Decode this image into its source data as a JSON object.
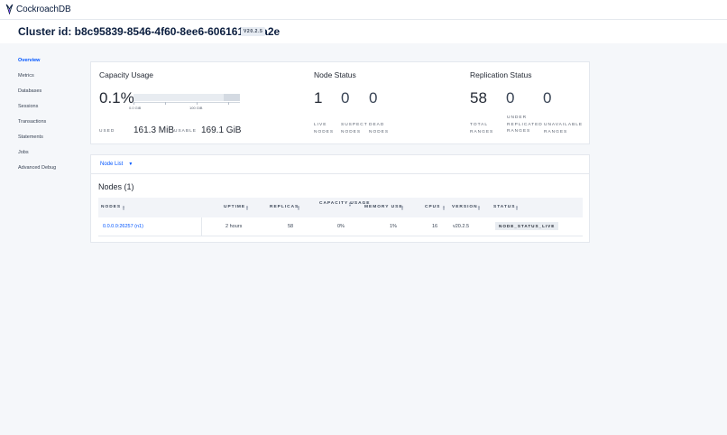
{
  "brand": {
    "name": "CockroachDB",
    "logo_icon": "cockroach-logo-icon"
  },
  "header": {
    "title": "Cluster id: b8c95839-8546-4f60-8ee6-606161ee8a2e",
    "version": "V20.2.5"
  },
  "sidebar": {
    "items": [
      {
        "label": "Overview",
        "active": true
      },
      {
        "label": "Metrics",
        "active": false
      },
      {
        "label": "Databases",
        "active": false
      },
      {
        "label": "Sessions",
        "active": false
      },
      {
        "label": "Transactions",
        "active": false
      },
      {
        "label": "Statements",
        "active": false
      },
      {
        "label": "Jobs",
        "active": false
      },
      {
        "label": "Advanced Debug",
        "active": false
      }
    ]
  },
  "capacity": {
    "title": "Capacity Usage",
    "percent": "0.1%",
    "used_fraction": 0.001,
    "scale_min": "0.0 GiB",
    "scale_max": "100 GiB",
    "used_label": "USED",
    "used_value": "161.3 MiB",
    "usable_label": "USABLE",
    "usable_value": "169.1 GiB"
  },
  "node_status": {
    "title": "Node Status",
    "live": {
      "value": "1",
      "label": "LIVE NODES"
    },
    "suspect": {
      "value": "0",
      "label": "SUSPECT NODES"
    },
    "dead": {
      "value": "0",
      "label": "DEAD NODES"
    }
  },
  "replication_status": {
    "title": "Replication Status",
    "total": {
      "value": "58",
      "label": "TOTAL RANGES"
    },
    "under": {
      "value": "0",
      "label": "UNDER REPLICATED RANGES"
    },
    "unavailable": {
      "value": "0",
      "label": "UNAVAILABLE RANGES"
    }
  },
  "node_list": {
    "dropdown_label": "Node List",
    "heading": "Nodes (1)",
    "columns": {
      "nodes": "NODES",
      "uptime": "UPTIME",
      "replicas": "REPLICAS",
      "capacity": "CAPACITY USAGE",
      "memory": "MEMORY USE",
      "cpus": "CPUS",
      "version": "VERSION",
      "status": "STATUS"
    },
    "rows": [
      {
        "node": "0.0.0.0:26257 (n1)",
        "uptime": "2 hours",
        "replicas": "58",
        "capacity": "0%",
        "memory": "1%",
        "cpus": "16",
        "version": "v20.2.5",
        "status": "NODE_STATUS_LIVE"
      }
    ]
  },
  "colors": {
    "accent": "#0055ff",
    "brand_navy": "#0b1e3f",
    "background": "#f5f7fa"
  }
}
